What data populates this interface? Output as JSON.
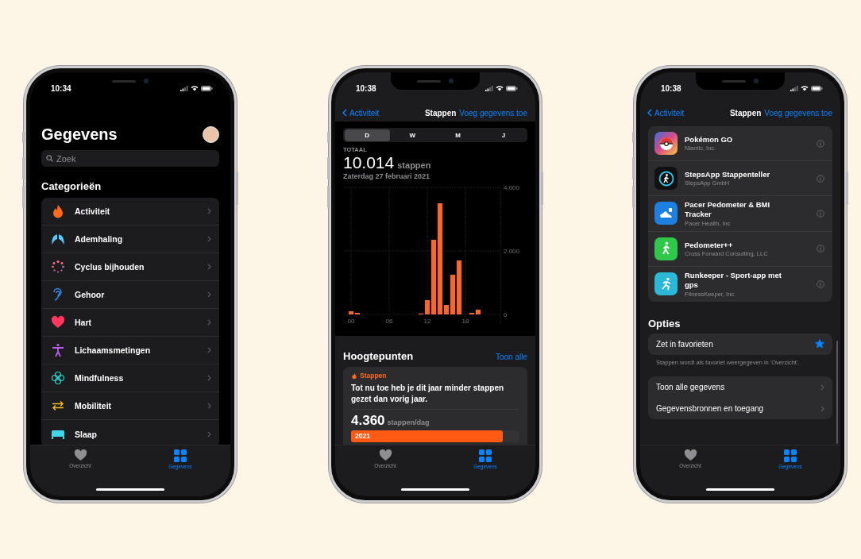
{
  "data_screen": {
    "status_bar": {
      "time": "10:34"
    },
    "title": "Gegevens",
    "search": {
      "placeholder": "Zoek"
    },
    "section_title": "Categorieën",
    "categories": [
      {
        "label": "Activiteit"
      },
      {
        "label": "Ademhaling"
      },
      {
        "label": "Cyclus bijhouden"
      },
      {
        "label": "Gehoor"
      },
      {
        "label": "Hart"
      },
      {
        "label": "Lichaamsmetingen"
      },
      {
        "label": "Mindfulness"
      },
      {
        "label": "Mobiliteit"
      },
      {
        "label": "Slaap"
      }
    ],
    "tab_bar": [
      {
        "label": "Overzicht",
        "selected": false
      },
      {
        "label": "Gegevens",
        "selected": true
      }
    ]
  },
  "steps_screen": {
    "status_bar": {
      "time": "10:38"
    },
    "nav": {
      "back": "Activiteit",
      "title": "Stappen",
      "action": "Voeg gegevens toe"
    },
    "segments": [
      {
        "label": "D",
        "selected": true
      },
      {
        "label": "W",
        "selected": false
      },
      {
        "label": "M",
        "selected": false
      },
      {
        "label": "J",
        "selected": false
      }
    ],
    "total": {
      "label": "TOTAAL",
      "value": "10.014",
      "unit": "stappen",
      "date": "Zaterdag 27 februari 2021"
    },
    "chart_data": {
      "type": "bar",
      "x": [
        0,
        1,
        2,
        3,
        4,
        5,
        6,
        7,
        8,
        9,
        10,
        11,
        12,
        13,
        14,
        15,
        16,
        17,
        18,
        19,
        20,
        21,
        22,
        23
      ],
      "xlim": [
        -0.5,
        23.5
      ],
      "grid": true,
      "series": [
        {
          "color": "#f5682a",
          "values": [
            100,
            50,
            0,
            0,
            0,
            0,
            0,
            0,
            0,
            0,
            0,
            30,
            450,
            2350,
            3500,
            300,
            1250,
            1700,
            0,
            50,
            150,
            0,
            0,
            0
          ]
        }
      ],
      "ylim": [
        0,
        4000
      ],
      "yticks": [
        {
          "value": 0,
          "label": "0"
        },
        {
          "value": 2000,
          "label": "2.000"
        },
        {
          "value": 4000,
          "label": "4.000"
        }
      ],
      "xticks": [
        {
          "value": 0,
          "label": "00"
        },
        {
          "value": 6,
          "label": "06"
        },
        {
          "value": 12,
          "label": "12"
        },
        {
          "value": 18,
          "label": "18"
        }
      ]
    },
    "highlights": {
      "title": "Hoogtepunten",
      "link": "Toon alle",
      "card": {
        "category": "Stappen",
        "text": "Tot nu toe heb je dit jaar minder stappen gezet dan vorig jaar.",
        "value": "4.360",
        "unit": "stappen/dag",
        "bar_label": "2021",
        "level": 0.9
      }
    },
    "tab_bar": [
      {
        "label": "Overzicht",
        "selected": false
      },
      {
        "label": "Gegevens",
        "selected": true
      }
    ]
  },
  "sources_screen": {
    "status_bar": {
      "time": "10:38"
    },
    "nav": {
      "back": "Activiteit",
      "title": "Stappen",
      "action": "Voeg gegevens toe"
    },
    "apps": [
      {
        "name": "Pokémon GO",
        "developer": "Niantic, Inc."
      },
      {
        "name": "StepsApp Stappenteller",
        "developer": "StepsApp GmbH"
      },
      {
        "name": "Pacer Pedometer & BMI Tracker",
        "developer": "Pacer Health, Inc"
      },
      {
        "name": "Pedometer++",
        "developer": "Cross Forward Consulting, LLC"
      },
      {
        "name": "Runkeeper - Sport-app met gps",
        "developer": "FitnessKeeper, Inc."
      }
    ],
    "options": {
      "title": "Opties",
      "favorite": {
        "label": "Zet in favorieten",
        "on": true
      },
      "note": "Stappen wordt als favoriet weergegeven in 'Overzicht'.",
      "links": [
        {
          "label": "Toon alle gegevens"
        },
        {
          "label": "Gegevensbronnen en toegang"
        }
      ]
    },
    "tab_bar": [
      {
        "label": "Overzicht",
        "selected": false
      },
      {
        "label": "Gegevens",
        "selected": true
      }
    ]
  }
}
